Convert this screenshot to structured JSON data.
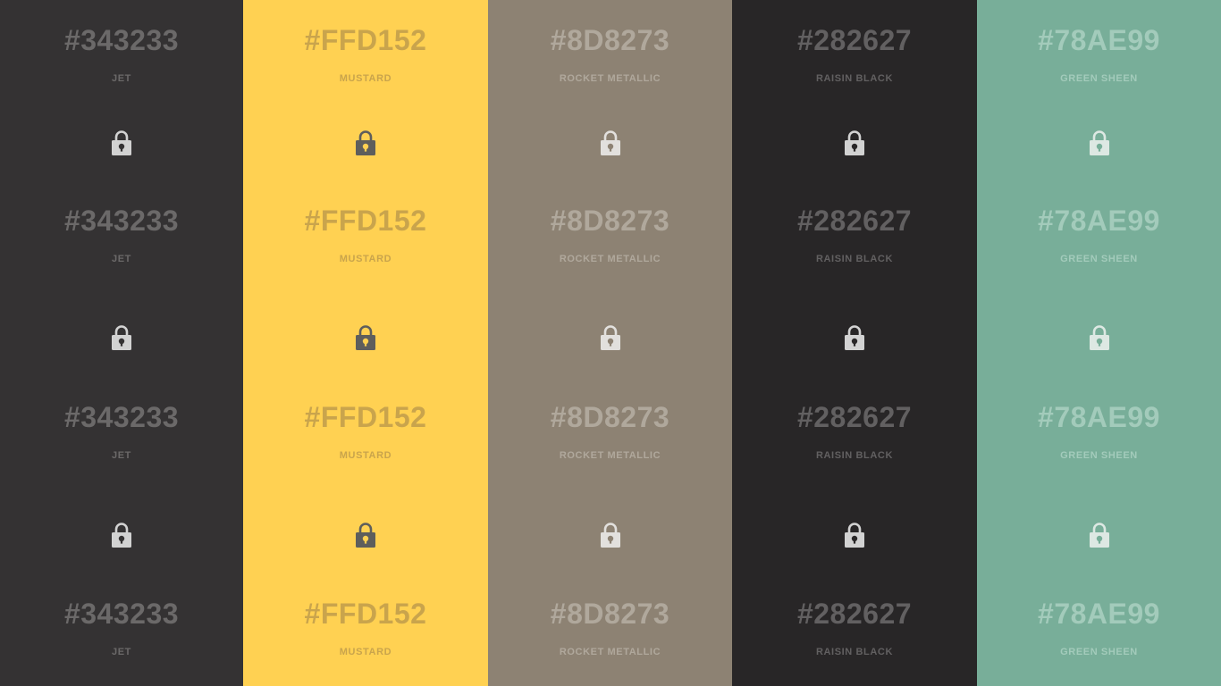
{
  "columns": [
    {
      "hex": "#343233",
      "name": "JET",
      "background": "#343233",
      "text_color": "#6b6969",
      "lock_body": "#d2d2d2",
      "lock_hole": "#343233"
    },
    {
      "hex": "#FFD152",
      "name": "MUSTARD",
      "background": "#FFD152",
      "text_color": "#c9a44c",
      "lock_body": "#5e5e5c",
      "lock_hole": "#FFD152"
    },
    {
      "hex": "#8D8273",
      "name": "ROCKET METALLIC",
      "background": "#8D8273",
      "text_color": "#b0a89c",
      "lock_body": "#e2e0dd",
      "lock_hole": "#8D8273"
    },
    {
      "hex": "#282627",
      "name": "RAISIN BLACK",
      "background": "#282627",
      "text_color": "#626061",
      "lock_body": "#d2d2d2",
      "lock_hole": "#282627"
    },
    {
      "hex": "#78AE99",
      "name": "GREEN SHEEN",
      "background": "#78AE99",
      "text_color": "#a3cbbb",
      "lock_body": "#dde8e3",
      "lock_hole": "#78AE99"
    }
  ]
}
